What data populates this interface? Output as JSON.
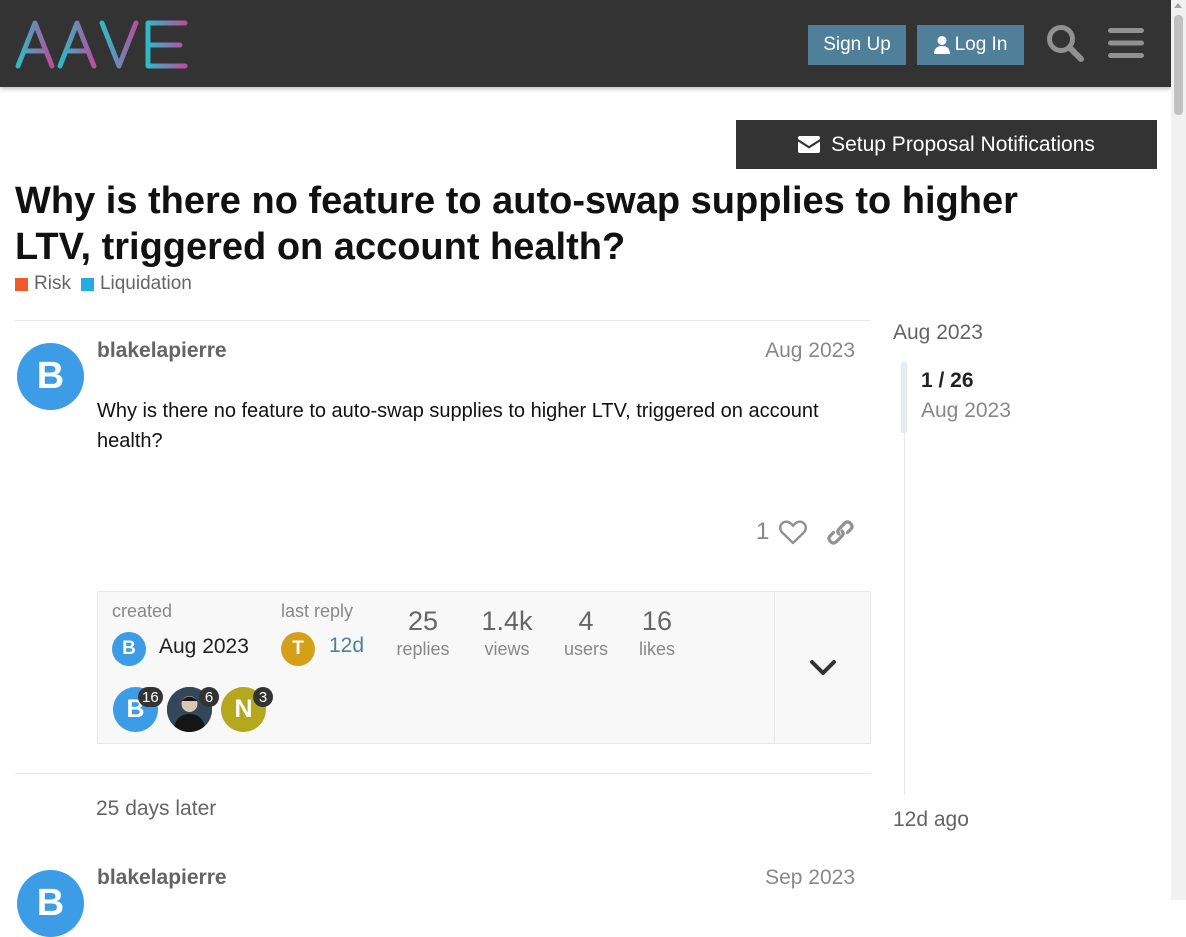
{
  "header": {
    "logo_text": "AAVE",
    "signup_label": "Sign Up",
    "login_label": "Log In",
    "search_icon": "search-icon",
    "menu_icon": "hamburger-menu-icon"
  },
  "notifications_button": {
    "label": "Setup Proposal Notifications",
    "icon": "envelope-icon"
  },
  "topic": {
    "title": "Why is there no feature to auto-swap supplies to higher LTV, triggered on account health?",
    "categories": [
      {
        "name": "Risk",
        "color": "#f15a2a"
      },
      {
        "name": "Liquidation",
        "color": "#25aae2"
      }
    ]
  },
  "posts": [
    {
      "username": "blakelapierre",
      "avatar_letter": "B",
      "avatar_color": "#3d9ce6",
      "date": "Aug 2023",
      "body": "Why is there no feature to auto-swap supplies to higher LTV, triggered on account health?",
      "like_count": "1"
    },
    {
      "username": "blakelapierre",
      "avatar_letter": "B",
      "avatar_color": "#3d9ce6",
      "date": "Sep 2023"
    }
  ],
  "topic_map": {
    "created_label": "created",
    "created_date": "Aug 2023",
    "last_reply_label": "last reply",
    "last_reply_date": "12d",
    "last_reply_avatar_letter": "T",
    "last_reply_avatar_color": "#d4a017",
    "stats": [
      {
        "num": "25",
        "label": "replies"
      },
      {
        "num": "1.4k",
        "label": "views"
      },
      {
        "num": "4",
        "label": "users"
      },
      {
        "num": "16",
        "label": "likes"
      }
    ],
    "participants": [
      {
        "letter": "B",
        "color": "#3d9ce6",
        "count": "16"
      },
      {
        "letter": "",
        "color": "#2b3a4a",
        "count": "6"
      },
      {
        "letter": "N",
        "color": "#b5a81f",
        "count": "3"
      }
    ]
  },
  "time_gap": "25 days later",
  "timeline": {
    "top_date": "Aug 2023",
    "position": "1 / 26",
    "current_date": "Aug 2023",
    "bottom_date": "12d ago"
  }
}
